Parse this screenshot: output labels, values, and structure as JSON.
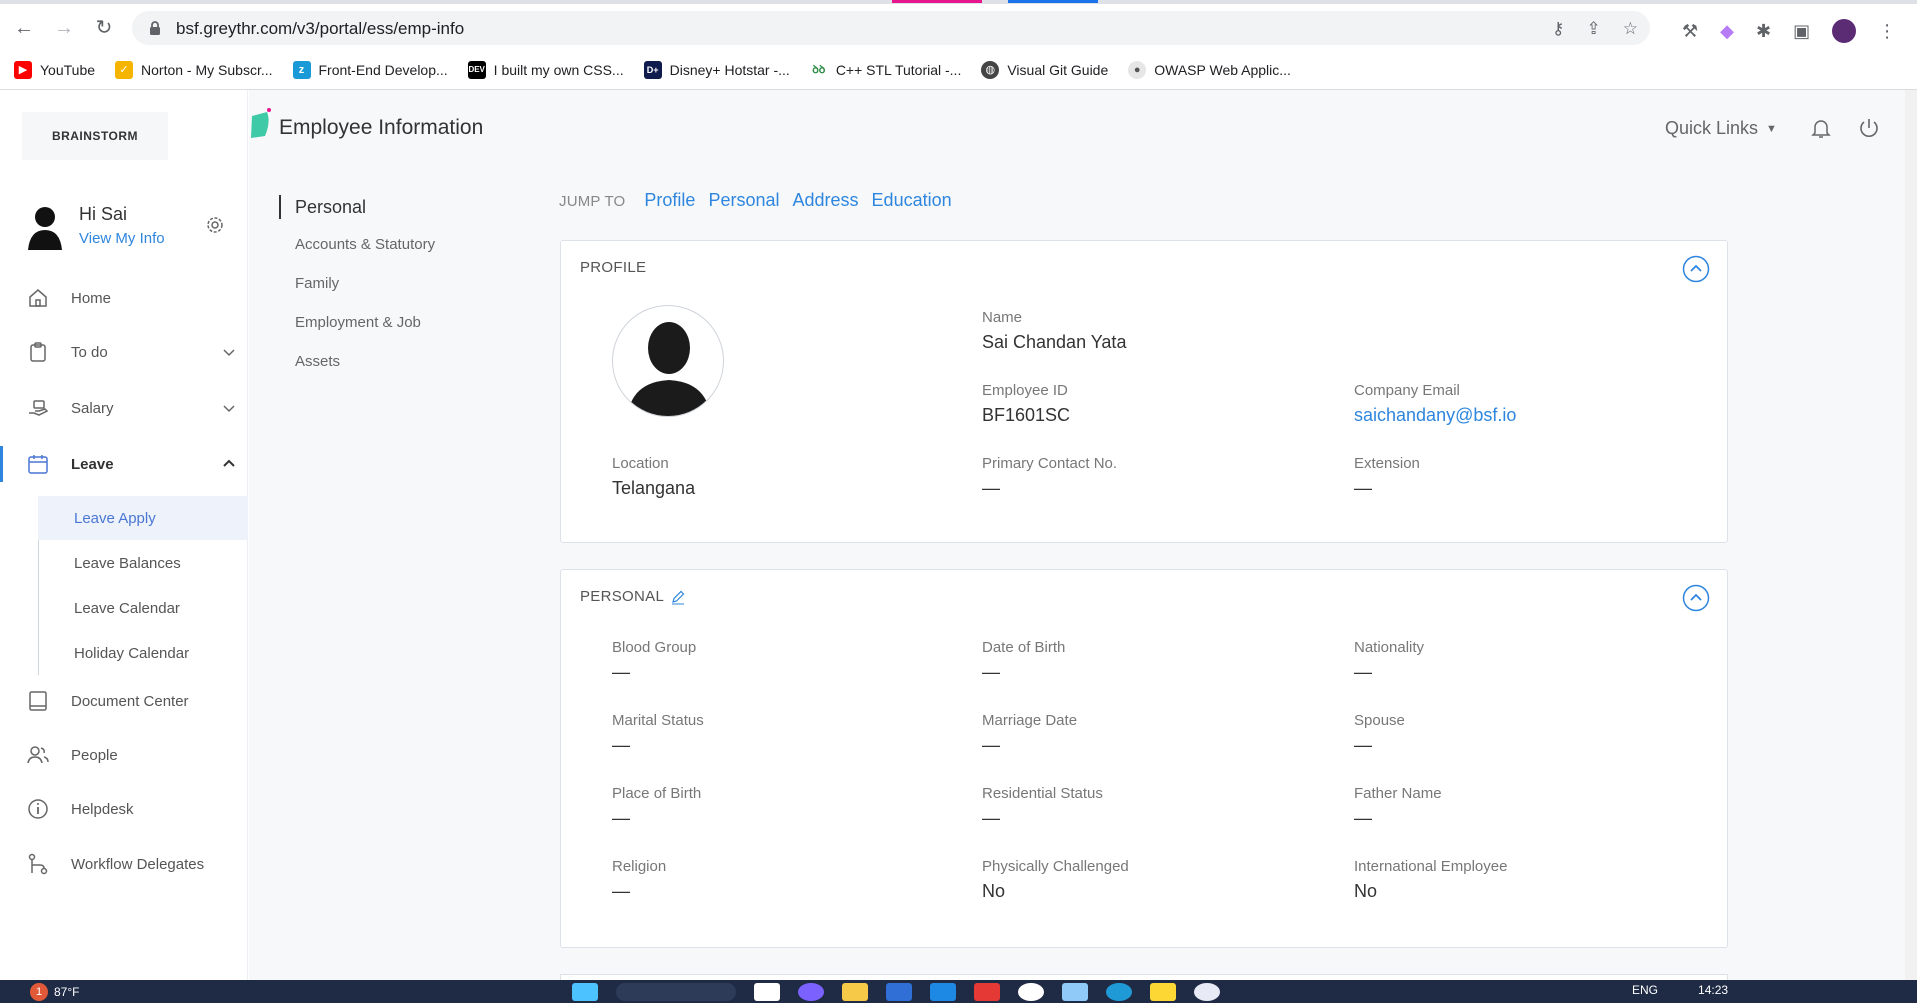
{
  "browser": {
    "url": "bsf.greythr.com/v3/portal/ess/emp-info",
    "bookmarks": [
      {
        "label": "YouTube",
        "icon": "youtube-icon",
        "color": "#ff0000"
      },
      {
        "label": "Norton - My Subscr...",
        "icon": "norton-icon",
        "color": "#f5b400"
      },
      {
        "label": "Front-End Develop...",
        "icon": "frontend-icon",
        "color": "#1a9bd7"
      },
      {
        "label": "I built my own CSS...",
        "icon": "dev-icon",
        "color": "#000000"
      },
      {
        "label": "Disney+ Hotstar -...",
        "icon": "hotstar-icon",
        "color": "#0f1b4c"
      },
      {
        "label": "C++ STL Tutorial -...",
        "icon": "gfg-icon",
        "color": "#2f8d46"
      },
      {
        "label": "Visual Git Guide",
        "icon": "globe-icon",
        "color": "#444444"
      },
      {
        "label": "OWASP Web Applic...",
        "icon": "github-icon",
        "color": "#555555"
      }
    ]
  },
  "sidebar": {
    "logo_text": "BRAINSTORM",
    "greeting": "Hi Sai",
    "view_info": "View My Info",
    "items": [
      {
        "label": "Home",
        "icon": "home-icon"
      },
      {
        "label": "To do",
        "icon": "clipboard-icon"
      },
      {
        "label": "Salary",
        "icon": "salary-hand-icon"
      },
      {
        "label": "Leave",
        "icon": "calendar-icon"
      },
      {
        "label": "Document Center",
        "icon": "book-icon"
      },
      {
        "label": "People",
        "icon": "people-icon"
      },
      {
        "label": "Helpdesk",
        "icon": "info-icon"
      },
      {
        "label": "Workflow Delegates",
        "icon": "workflow-icon"
      }
    ],
    "leave_sub": [
      "Leave Apply",
      "Leave Balances",
      "Leave Calendar",
      "Holiday Calendar"
    ]
  },
  "header": {
    "title": "Employee Information",
    "quick_links": "Quick Links"
  },
  "subnav": [
    "Personal",
    "Accounts & Statutory",
    "Family",
    "Employment & Job",
    "Assets"
  ],
  "jump": {
    "label": "JUMP TO",
    "links": [
      "Profile",
      "Personal",
      "Address",
      "Education"
    ]
  },
  "profile": {
    "title": "PROFILE",
    "name_label": "Name",
    "name": "Sai Chandan Yata",
    "emp_id_label": "Employee ID",
    "emp_id": "BF1601SC",
    "email_label": "Company Email",
    "email": "saichandany@bsf.io",
    "location_label": "Location",
    "location": "Telangana",
    "contact_label": "Primary Contact No.",
    "contact": "—",
    "extension_label": "Extension",
    "extension": "—"
  },
  "personal": {
    "title": "PERSONAL",
    "fields": [
      {
        "label": "Blood Group",
        "value": "—"
      },
      {
        "label": "Date of Birth",
        "value": "—"
      },
      {
        "label": "Nationality",
        "value": "—"
      },
      {
        "label": "Marital Status",
        "value": "—"
      },
      {
        "label": "Marriage Date",
        "value": "—"
      },
      {
        "label": "Spouse",
        "value": "—"
      },
      {
        "label": "Place of Birth",
        "value": "—"
      },
      {
        "label": "Residential Status",
        "value": "—"
      },
      {
        "label": "Father Name",
        "value": "—"
      },
      {
        "label": "Religion",
        "value": "—"
      },
      {
        "label": "Physically Challenged",
        "value": "No"
      },
      {
        "label": "International Employee",
        "value": "No"
      }
    ]
  },
  "taskbar": {
    "badge": "1",
    "weather": "87°F",
    "lang": "ENG",
    "time": "14:23"
  },
  "colors": {
    "accent": "#2e86de",
    "leaf": "#3ec9a7"
  }
}
